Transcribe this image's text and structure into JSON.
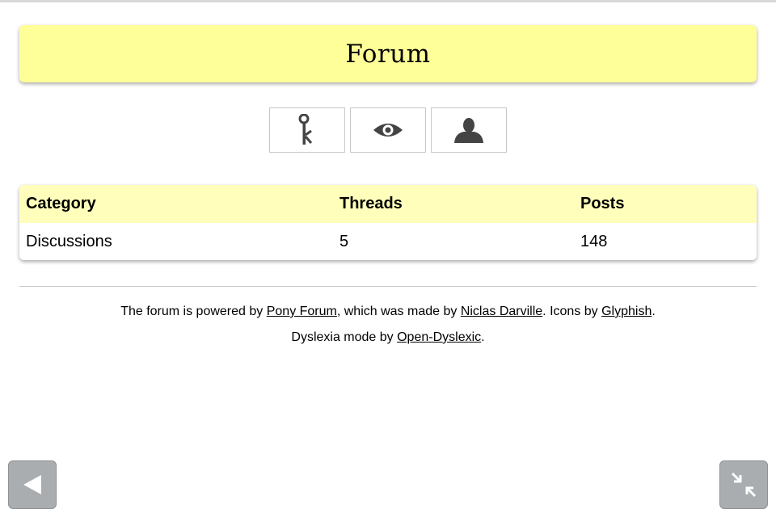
{
  "header": {
    "title": "Forum"
  },
  "toolbar": {
    "icons": [
      "key-icon",
      "eye-icon",
      "user-icon"
    ]
  },
  "table": {
    "columns": [
      "Category",
      "Threads",
      "Posts"
    ],
    "rows": [
      {
        "category": "Discussions",
        "threads": "5",
        "posts": "148"
      }
    ]
  },
  "footer": {
    "line1_prefix": "The forum is powered by ",
    "pony_forum_link": "Pony Forum",
    "line1_middle": ", which was made by ",
    "author_link": "Niclas Darville",
    "line1_icons": ". Icons by ",
    "glyphish_link": "Glyphish",
    "line1_end": ".",
    "line2_prefix": "Dyslexia mode by ",
    "open_dyslexic_link": "Open-Dyslexic",
    "line2_end": "."
  },
  "nav": {
    "back_icon": "back-arrow-icon",
    "fullscreen_icon": "collapse-icon"
  },
  "colors": {
    "header_bg": "#ffff99",
    "table_header_bg": "#ffffbb",
    "nav_button_bg": "#a9adb0"
  }
}
